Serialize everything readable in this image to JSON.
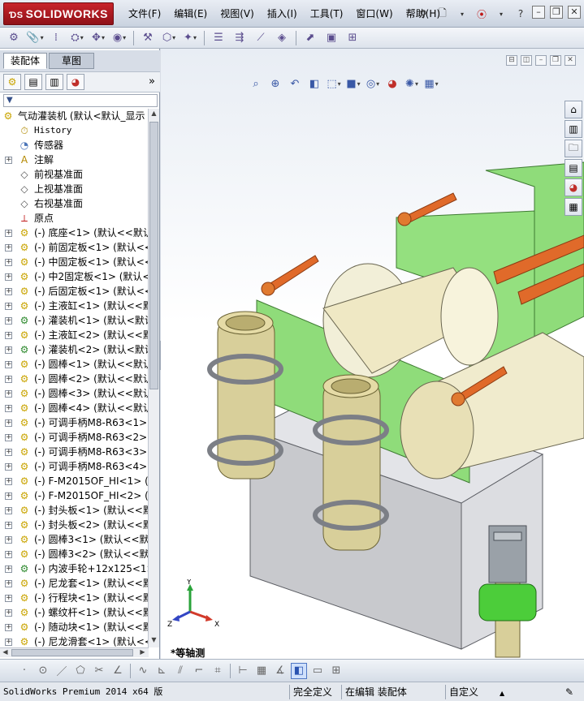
{
  "app": {
    "logo_text": "SOLIDWORKS",
    "menu": [
      "文件(F)",
      "编辑(E)",
      "视图(V)",
      "插入(I)",
      "工具(T)",
      "窗口(W)",
      "帮助(H)"
    ]
  },
  "panel": {
    "tabs": [
      "装配体",
      "草图"
    ],
    "more": "»",
    "filter_glyph": "▼"
  },
  "tree": {
    "root": "气动灌装机 (默认<默认_显示",
    "items": [
      {
        "label": "History",
        "mono": true,
        "icon": "history-icon",
        "expand": false
      },
      {
        "label": "传感器",
        "icon": "sensor-icon",
        "expand": false
      },
      {
        "label": "注解",
        "icon": "annotation-icon",
        "expand": true
      },
      {
        "label": "前视基准面",
        "icon": "plane-icon",
        "expand": false
      },
      {
        "label": "上视基准面",
        "icon": "plane-icon",
        "expand": false
      },
      {
        "label": "右视基准面",
        "icon": "plane-icon",
        "expand": false
      },
      {
        "label": "原点",
        "icon": "origin-icon",
        "expand": false
      },
      {
        "label": "(-) 底座<1> (默认<<默认",
        "icon": "part-icon",
        "expand": true
      },
      {
        "label": "(-) 前固定板<1> (默认<<",
        "icon": "part-icon",
        "expand": true
      },
      {
        "label": "(-) 中固定板<1> (默认<<",
        "icon": "part-icon",
        "expand": true
      },
      {
        "label": "(-) 中2固定板<1> (默认<",
        "icon": "part-icon",
        "expand": true
      },
      {
        "label": "(-) 后固定板<1> (默认<<",
        "icon": "part-icon",
        "expand": true
      },
      {
        "label": "(-) 主液缸<1> (默认<<默",
        "icon": "part-icon",
        "expand": true
      },
      {
        "label": "(-) 灌装机<1> (默认<默认",
        "icon": "assembly-icon",
        "expand": true
      },
      {
        "label": "(-) 主液缸<2> (默认<<默",
        "icon": "part-icon",
        "expand": true
      },
      {
        "label": "(-) 灌装机<2> (默认<默认",
        "icon": "assembly-icon",
        "expand": true
      },
      {
        "label": "(-) 圆棒<1> (默认<<默认",
        "icon": "part-icon",
        "expand": true
      },
      {
        "label": "(-) 圆棒<2> (默认<<默认",
        "icon": "part-icon",
        "expand": true
      },
      {
        "label": "(-) 圆棒<3> (默认<<默认",
        "icon": "part-icon",
        "expand": true
      },
      {
        "label": "(-) 圆棒<4> (默认<<默认",
        "icon": "part-icon",
        "expand": true
      },
      {
        "label": "(-) 可调手柄M8-R63<1> (",
        "icon": "part-icon",
        "expand": true
      },
      {
        "label": "(-) 可调手柄M8-R63<2> (",
        "icon": "part-icon",
        "expand": true
      },
      {
        "label": "(-) 可调手柄M8-R63<3> (",
        "icon": "part-icon",
        "expand": true
      },
      {
        "label": "(-) 可调手柄M8-R63<4> (",
        "icon": "part-icon",
        "expand": true
      },
      {
        "label": "(-) F-M2015OF_HI<1> (默",
        "icon": "part-icon",
        "expand": true
      },
      {
        "label": "(-) F-M2015OF_HI<2> (默",
        "icon": "part-icon",
        "expand": true
      },
      {
        "label": "(-) 封头板<1> (默认<<默",
        "icon": "part-icon",
        "expand": true
      },
      {
        "label": "(-) 封头板<2> (默认<<默",
        "icon": "part-icon",
        "expand": true
      },
      {
        "label": "(-) 圆棒3<1> (默认<<默认",
        "icon": "part-icon",
        "expand": true
      },
      {
        "label": "(-) 圆棒3<2> (默认<<默认",
        "icon": "part-icon",
        "expand": true
      },
      {
        "label": "(-) 内波手轮+12x125<1>",
        "icon": "assembly-icon",
        "expand": true
      },
      {
        "label": "(-) 尼龙套<1> (默认<<默",
        "icon": "part-icon",
        "expand": true
      },
      {
        "label": "(-) 行程块<1> (默认<<默",
        "icon": "part-icon",
        "expand": true
      },
      {
        "label": "(-) 螺纹杆<1> (默认<<默",
        "icon": "part-icon",
        "expand": true
      },
      {
        "label": "(-) 随动块<1> (默认<<默",
        "icon": "part-icon",
        "expand": true
      },
      {
        "label": "(-) 尼龙滑套<1> (默认<<默",
        "icon": "part-icon",
        "expand": true
      }
    ]
  },
  "viewport": {
    "view_name": "*等轴测",
    "triad": {
      "x": "X",
      "y": "Y",
      "z": "Z"
    }
  },
  "status": {
    "product": "SolidWorks Premium 2014 x64 版",
    "definition": "完全定义",
    "mode": "在编辑 装配体",
    "units": "自定义"
  }
}
